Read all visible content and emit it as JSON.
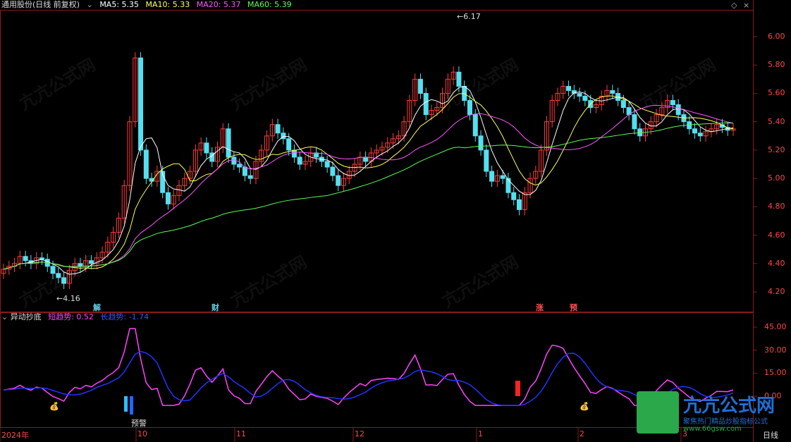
{
  "header": {
    "title": "通用股份(日线 前复权)",
    "ma5": "MA5: 5.35",
    "ma10": "MA10: 5.33",
    "ma20": "MA20: 5.37",
    "ma60": "MA60: 5.39",
    "colors": {
      "ma5": "#ffffff",
      "ma10": "#ffff55",
      "ma20": "#ff55ff",
      "ma60": "#55ff55"
    }
  },
  "price_axis": [
    "6.00",
    "5.80",
    "5.60",
    "5.40",
    "5.20",
    "5.00",
    "4.80",
    "4.60",
    "4.40",
    "4.20"
  ],
  "indicator_axis": [
    "45.00",
    "30.00",
    "15.00",
    "0.00"
  ],
  "annotations": {
    "high": "6.17",
    "low": "4.16"
  },
  "event_marks": [
    "解",
    "财",
    "涨",
    "预"
  ],
  "indicator": {
    "name": "异动抄底",
    "short_label": "短趋势: 0.52",
    "long_label": "长趋势: -1.74",
    "warning": "预警"
  },
  "date_axis": [
    "2024年",
    "10",
    "11",
    "12",
    "1",
    "2",
    "3"
  ],
  "period_label": "日线",
  "watermark": {
    "name": "亢亢公式网",
    "slogan": "聚焦热门精品炒股指标公式",
    "url": "www.66gsw.com"
  },
  "chart_data": {
    "type": "line",
    "series": [
      {
        "name": "MA5",
        "values": [
          5.35
        ]
      },
      {
        "name": "MA10",
        "values": [
          5.33
        ]
      },
      {
        "name": "MA20",
        "values": [
          5.37
        ]
      },
      {
        "name": "MA60",
        "values": [
          5.39
        ]
      }
    ],
    "ylim": [
      4.2,
      6.1
    ],
    "indicator_ylim": [
      -8,
      48
    ]
  }
}
